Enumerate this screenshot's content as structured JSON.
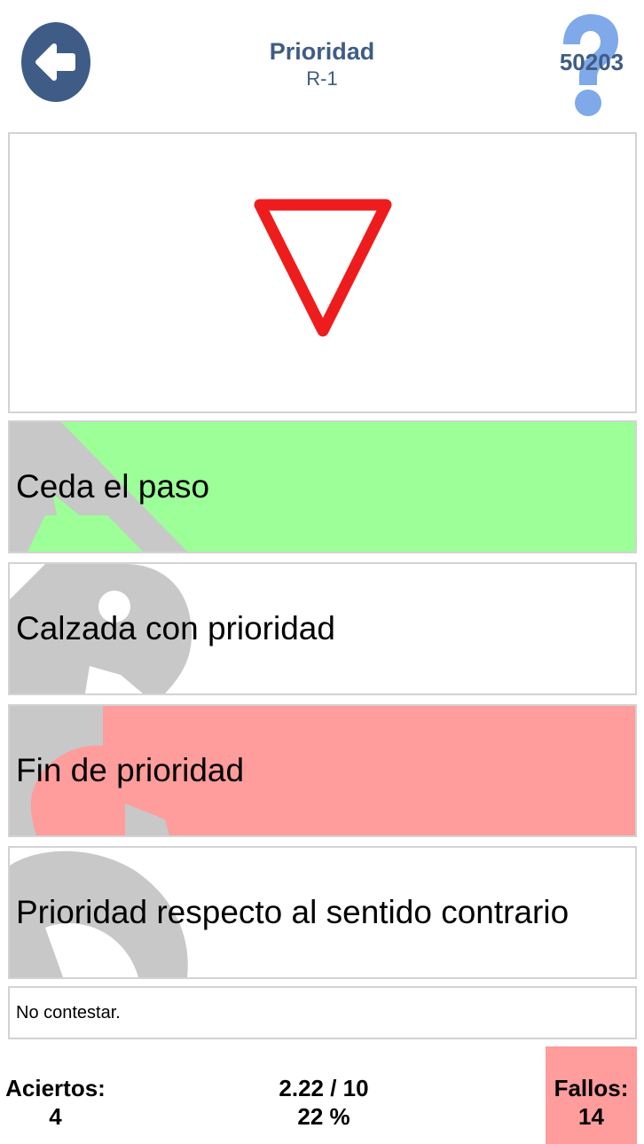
{
  "header": {
    "title": "Prioridad",
    "subtitle": "R-1",
    "question_id": "50203",
    "back_icon": "arrow-left-icon",
    "help_icon": "question-mark-icon"
  },
  "sign": {
    "icon": "yield-sign-icon",
    "color": "#ee1c1c"
  },
  "answers": [
    {
      "letter": "A",
      "label": "Ceda el paso",
      "state": "correct"
    },
    {
      "letter": "B",
      "label": "Calzada con prioridad",
      "state": "neutral"
    },
    {
      "letter": "C",
      "label": "Fin de prioridad",
      "state": "wrong"
    },
    {
      "letter": "D",
      "label": "Prioridad respecto al sentido contrario",
      "state": "neutral"
    }
  ],
  "no_answer": {
    "label": "No contestar."
  },
  "stats": {
    "hits_label": "Aciertos:",
    "hits_value": "4",
    "score": "2.22 / 10",
    "percent": "22 %",
    "fails_label": "Fallos:",
    "fails_value": "14"
  },
  "colors": {
    "primary": "#3e5c86",
    "help": "#7fa9e8",
    "correct": "#9cff97",
    "wrong": "#ff9c9c",
    "border": "#d3d3d3",
    "letter_watermark": "#c8c8c8"
  }
}
